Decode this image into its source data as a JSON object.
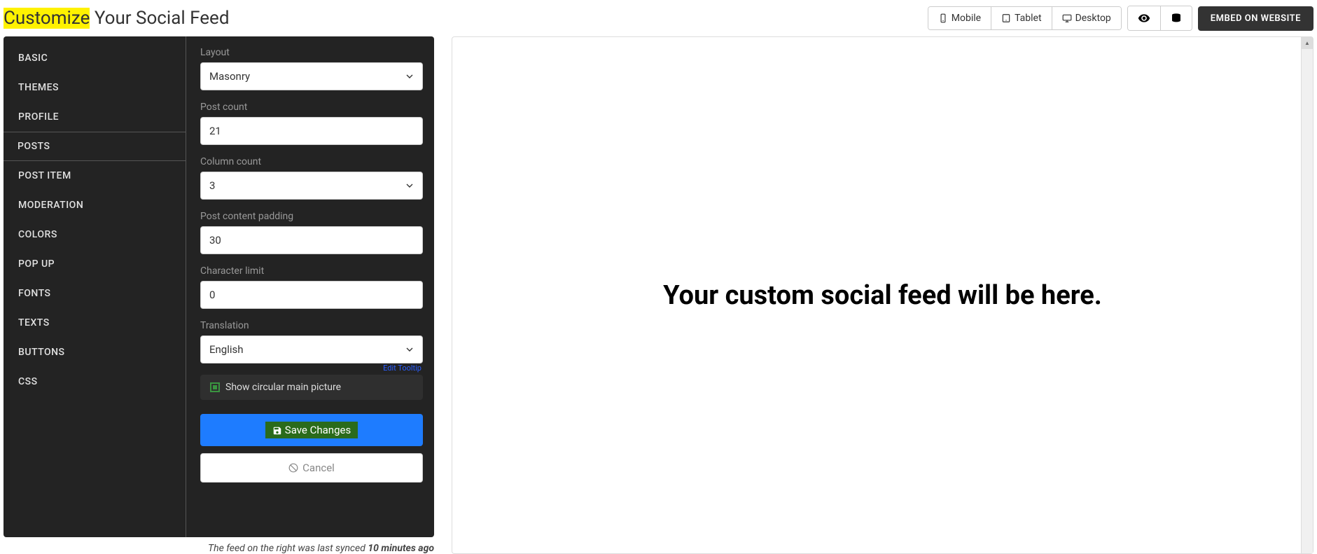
{
  "header": {
    "title_highlighted": "Customize",
    "title_rest": " Your Social Feed",
    "devices": {
      "mobile": "Mobile",
      "tablet": "Tablet",
      "desktop": "Desktop"
    },
    "embed_label": "EMBED ON WEBSITE"
  },
  "sidebar": {
    "items": [
      {
        "label": "BASIC"
      },
      {
        "label": "THEMES"
      },
      {
        "label": "PROFILE"
      },
      {
        "label": "POSTS"
      },
      {
        "label": "POST ITEM"
      },
      {
        "label": "MODERATION"
      },
      {
        "label": "COLORS"
      },
      {
        "label": "POP UP"
      },
      {
        "label": "FONTS"
      },
      {
        "label": "TEXTS"
      },
      {
        "label": "BUTTONS"
      },
      {
        "label": "CSS"
      }
    ]
  },
  "form": {
    "layout_label": "Layout",
    "layout_value": "Masonry",
    "post_count_label": "Post count",
    "post_count_value": "21",
    "column_count_label": "Column count",
    "column_count_value": "3",
    "padding_label": "Post content padding",
    "padding_value": "30",
    "char_limit_label": "Character limit",
    "char_limit_value": "0",
    "translation_label": "Translation",
    "translation_value": "English",
    "checkbox_label": "Show circular main picture",
    "edit_tooltip": "Edit Tooltip",
    "save_label": "Save Changes",
    "cancel_label": "Cancel"
  },
  "sync_note_prefix": "The feed on the right was last synced ",
  "sync_note_bold": "10 minutes ago",
  "preview": {
    "placeholder_text": "Your custom social feed will be here."
  }
}
